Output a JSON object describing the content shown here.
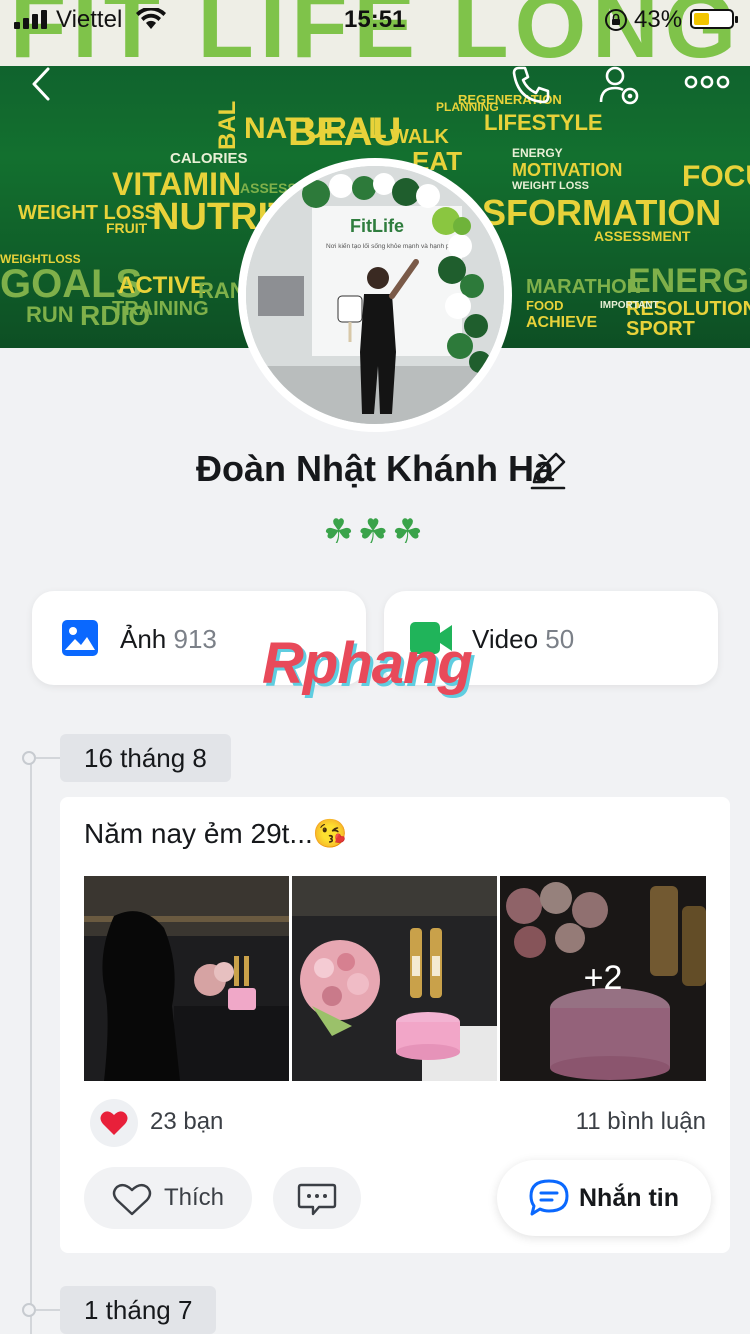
{
  "status_bar": {
    "carrier": "Viettel",
    "time": "15:51",
    "battery_percent": "43%",
    "battery_level": 0.43,
    "icons": [
      "signal-icon",
      "wifi-icon",
      "orientation-lock-icon",
      "battery-icon"
    ]
  },
  "cover": {
    "band_text": "FIT LIFE LONG AN",
    "words": [
      "BAL",
      "NATURAL",
      "BEAU",
      "WALK",
      "PLANNING",
      "REGENERATION",
      "LIFESTYLE",
      "ENERGY",
      "CALORIES",
      "VITAMIN",
      "EAT",
      "MOTIVATION",
      "WEIGHT LOSS",
      "FOCUS",
      "WEIGHT LOSS",
      "NUTRITI",
      "ASSESS",
      "SFORMATION",
      "ASSESSMENT",
      "FRUIT",
      "WEIGHTLOSS",
      "GOALS",
      "ACTIVE",
      "TRAINING",
      "MARATHON",
      "ENERGY",
      "RUN",
      "FOOD",
      "RESOLUTION",
      "ACHIEVE",
      "SPORT",
      "RDIO",
      "RANCE",
      "IMPORTANT"
    ],
    "colors": {
      "green": "#13702f",
      "lime": "#7ac142",
      "yellow": "#e8d23a"
    }
  },
  "nav": {
    "icons": [
      "back-icon",
      "phone-icon",
      "profile-settings-icon",
      "more-icon"
    ]
  },
  "profile": {
    "name": "Đoàn Nhật Khánh Hà",
    "bio": "☘☘☘",
    "avatar_sign_text": "FitLife",
    "avatar_sign_sub": "Nơi kiến tạo lối sống khỏe mạnh và hạnh phúc"
  },
  "media": {
    "photos_label": "Ảnh",
    "photos_count": "913",
    "videos_label": "Video",
    "videos_count": "50",
    "photos_color": "#0a68fe",
    "videos_color": "#20b45a"
  },
  "watermark": "Rphang",
  "timeline": [
    {
      "date": "16 tháng 8",
      "text": "Năm nay ẻm 29t...😘",
      "extra_photos": "+2",
      "reactions": "23 bạn",
      "comments": "11 bình luận",
      "like_label": "Thích"
    },
    {
      "date": "1 tháng 7"
    }
  ],
  "message_button": {
    "label": "Nhắn tin",
    "color": "#0a68fe"
  }
}
